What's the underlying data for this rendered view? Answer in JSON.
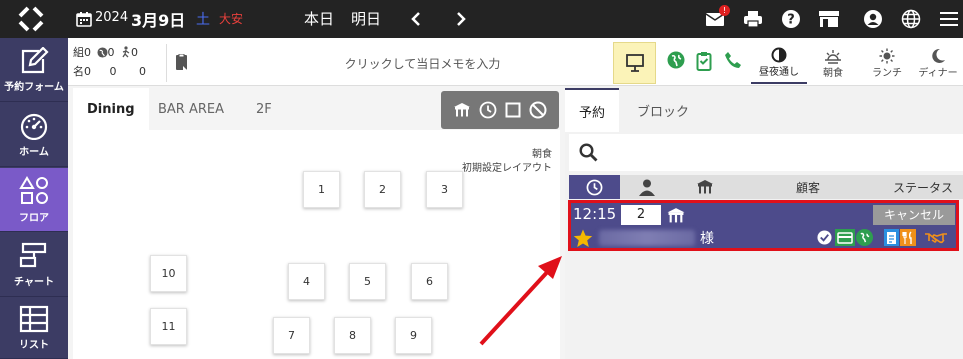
{
  "topbar": {
    "year": "2024",
    "date": "3月9日",
    "weekday": "土",
    "rokuyo": "大安",
    "today_label": "本日",
    "tomorrow_label": "明日",
    "mail_badge": "!",
    "colors": {
      "bg": "#232323",
      "weekday": "#4a6cf0",
      "rokuyo": "#e8403c",
      "badge": "#e02020"
    },
    "icons": [
      "logo-icon",
      "calendar-icon",
      "chevron-left-icon",
      "chevron-right-icon",
      "mail-icon",
      "printer-icon",
      "help-icon",
      "shop-icon",
      "user-icon",
      "globe-icon",
      "hamburger-icon"
    ]
  },
  "sidebar": {
    "items": [
      {
        "label": "予約フォーム",
        "icon": "edit-icon"
      },
      {
        "label": "ホーム",
        "icon": "gauge-icon"
      },
      {
        "label": "フロア",
        "icon": "shapes-icon",
        "active": true
      },
      {
        "label": "チャート",
        "icon": "chart-icon"
      },
      {
        "label": "リスト",
        "icon": "list-icon"
      }
    ]
  },
  "infobar": {
    "groups_label": "組",
    "names_label": "名",
    "groups_count": "0",
    "names_count": "0",
    "web_groups": "0",
    "web_names": "0",
    "walkin_groups": "0",
    "walkin_names": "0",
    "memo_placeholder": "クリックして当日メモを入力",
    "meals": [
      {
        "label": "昼夜通し",
        "active": true
      },
      {
        "label": "朝食"
      },
      {
        "label": "ランチ"
      },
      {
        "label": "ディナー"
      }
    ]
  },
  "floor": {
    "tabs": [
      "Dining",
      "BAR AREA",
      "2F"
    ],
    "active_tab": "Dining",
    "meal_label": "朝食",
    "layout_label": "初期設定レイアウト",
    "tables": [
      "1",
      "2",
      "3",
      "4",
      "5",
      "6",
      "7",
      "8",
      "9",
      "10",
      "11"
    ]
  },
  "reservations": {
    "tabs": [
      "予約",
      "ブロック"
    ],
    "active_tab": "予約",
    "search_placeholder": "",
    "headers": {
      "guest": "顧客",
      "status": "ステータス"
    },
    "rows": [
      {
        "time": "12:15",
        "party": "2",
        "honorific": "様",
        "status": "キャンセル"
      }
    ],
    "colors": {
      "row_bg": "#4d4b8b",
      "highlight": "#e0101a",
      "status_bg": "#9a9a9a"
    }
  }
}
